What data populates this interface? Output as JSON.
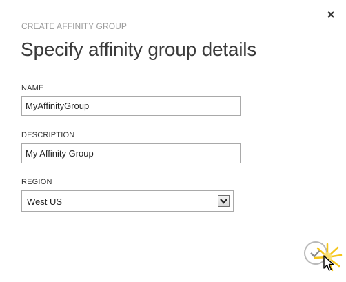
{
  "dialog": {
    "label": "CREATE AFFINITY GROUP",
    "title": "Specify affinity group details"
  },
  "form": {
    "name": {
      "label": "NAME",
      "value": "MyAffinityGroup"
    },
    "description": {
      "label": "DESCRIPTION",
      "value": "My Affinity Group"
    },
    "region": {
      "label": "REGION",
      "selected": "West US"
    }
  },
  "icons": {
    "close": "close-icon",
    "dropdown": "chevron-down-icon",
    "confirm": "checkmark-icon",
    "pointer": "mouse-pointer-icon"
  },
  "colors": {
    "label": "#9a9a9a",
    "title": "#3b3b3b",
    "border": "#a9a9a9",
    "confirm_ring": "#b9b9b9",
    "click_highlight": "#f5c518"
  }
}
